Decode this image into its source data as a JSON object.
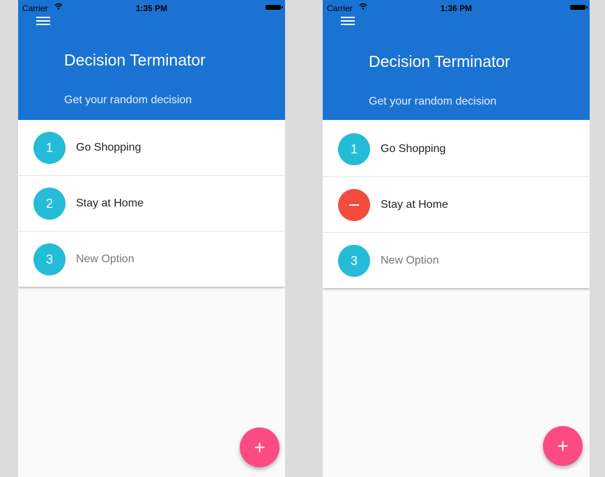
{
  "screens": [
    {
      "status": {
        "carrier": "Carrier",
        "time": "1:35 PM"
      },
      "header": {
        "title": "Decision Terminator",
        "subtitle": "Get your random decision"
      },
      "options": [
        {
          "badge": "1",
          "label": "Go Shopping",
          "state": "normal"
        },
        {
          "badge": "2",
          "label": "Stay at Home",
          "state": "normal"
        },
        {
          "badge": "3",
          "label": "New Option",
          "state": "placeholder"
        }
      ],
      "fab_label": "+"
    },
    {
      "status": {
        "carrier": "Carrier",
        "time": "1:36 PM"
      },
      "header": {
        "title": "Decision Terminator",
        "subtitle": "Get your random decision"
      },
      "options": [
        {
          "badge": "1",
          "label": "Go Shopping",
          "state": "normal"
        },
        {
          "badge": "",
          "label": "Stay at Home",
          "state": "remove",
          "icon": "minus-icon"
        },
        {
          "badge": "3",
          "label": "New Option",
          "state": "placeholder"
        }
      ],
      "fab_label": "+"
    }
  ],
  "colors": {
    "header_bg": "#1a73d2",
    "badge_teal": "#24bcd6",
    "badge_remove": "#f24d3f",
    "fab": "#fc4a85"
  }
}
